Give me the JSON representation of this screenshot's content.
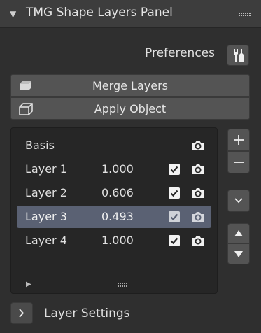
{
  "panel": {
    "title": "TMG Shape Layers Panel",
    "preferences_label": "Preferences",
    "merge_label": "Merge Layers",
    "apply_label": "Apply Object"
  },
  "layers": [
    {
      "name": "Basis",
      "value": "",
      "checked": null,
      "selected": false
    },
    {
      "name": "Layer 1",
      "value": "1.000",
      "checked": true,
      "selected": false
    },
    {
      "name": "Layer 2",
      "value": "0.606",
      "checked": true,
      "selected": false
    },
    {
      "name": "Layer 3",
      "value": "0.493",
      "checked": true,
      "selected": true
    },
    {
      "name": "Layer 4",
      "value": "1.000",
      "checked": true,
      "selected": false
    }
  ],
  "settings": {
    "label": "Layer Settings"
  },
  "icons": {
    "collapse": "triangle-down-icon",
    "drag": "grip-icon",
    "preferences": "wrench-screwdriver-icon",
    "merge": "layers-icon",
    "apply": "cube-icon",
    "render": "camera-icon",
    "add": "plus-icon",
    "remove": "minus-icon",
    "menu": "chevron-down-icon",
    "move_up": "triangle-up-icon",
    "move_down": "triangle-down-icon",
    "expand": "chevron-right-icon"
  },
  "colors": {
    "selected_row": "#5a6173",
    "button": "#545454",
    "panel_bg": "#2f2f2f"
  }
}
